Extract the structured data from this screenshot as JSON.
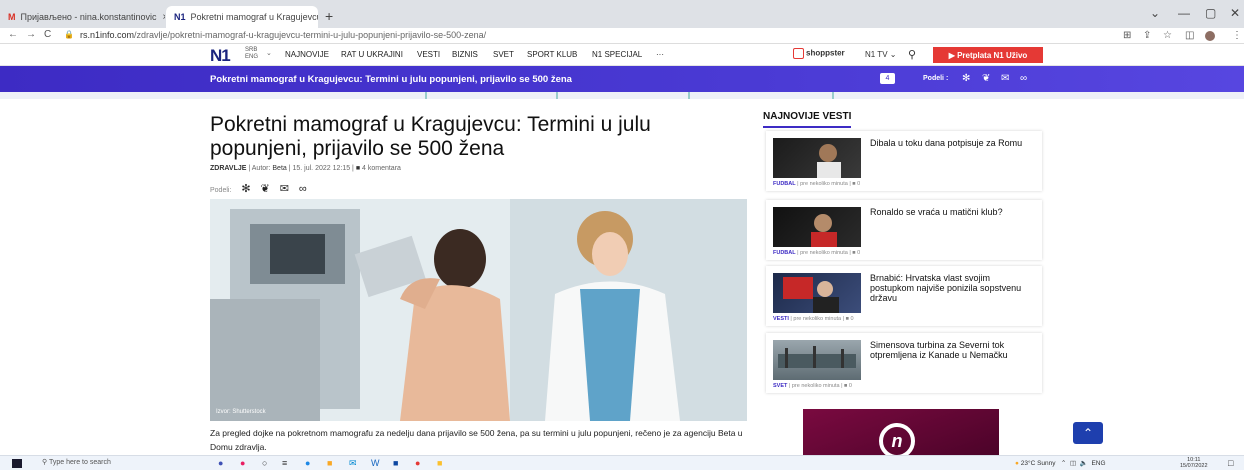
{
  "browser": {
    "tabs": [
      {
        "favicon": "M",
        "label": "Пријављено - nina.konstantinovic",
        "close": "×"
      },
      {
        "favicon": "N1",
        "label": "Pokretni mamograf u Kragujevcu",
        "close": "×"
      }
    ],
    "new_tab": "+",
    "url_host": "rs.n1info.com",
    "url_path": "/zdravlje/pokretni-mamograf-u-kragujevcu-termini-u-julu-popunjeni-prijavilo-se-500-zena/",
    "nav": {
      "back": "←",
      "forward": "→",
      "reload": "C"
    },
    "window": {
      "chevron": "⌄",
      "minimize": "—",
      "maximize": "▢",
      "close": "✕"
    }
  },
  "site": {
    "logo": "N1",
    "lang": {
      "primary": "SRB",
      "secondary": "ENG"
    },
    "menu": [
      "NAJNOVIJE",
      "RAT U UKRAJINI",
      "VESTI",
      "BIZNIS",
      "SVET",
      "SPORT KLUB",
      "N1 SPECIJAL",
      "···"
    ],
    "shoppster": "shoppster",
    "n1tv": "N1 TV ⌄",
    "subscribe": "▶ Pretplata N1 Uživo"
  },
  "sticky": {
    "title": "Pokretni mamograf u Kragujevcu: Termini u julu popunjeni, prijavilo se 500 žena",
    "comment_count": "4",
    "share_label": "Podeli :"
  },
  "article": {
    "title": "Pokretni mamograf u Kragujevcu: Termini u julu popunjeni, prijavilo se 500 žena",
    "category": "ZDRAVLJE",
    "author_prefix": " | Autor: ",
    "author": "Beta",
    "date": " | 15. jul. 2022 12:15 | ",
    "comments": "4 komentara",
    "share_label": "Podeli:",
    "image_caption": "Izvor: Shutterstock",
    "lead": "Za pregled dojke na pokretnom mamografu za nedelju dana prijavilo se 500 žena, pa su termini u julu popunjeni, rečeno je za agenciju Beta u Domu zdravlja."
  },
  "sidebar": {
    "title": "NAJNOVIJE VESTI",
    "items": [
      {
        "title": "Dibala u toku dana potpisuje za Romu",
        "category": "FUDBAL",
        "time": " | pre nekoliko minuta | ",
        "comments": "0"
      },
      {
        "title": "Ronaldo se vraća u matični klub?",
        "category": "FUDBAL",
        "time": " | pre nekoliko minuta | ",
        "comments": "0"
      },
      {
        "title": "Brnabić: Hrvatska vlast svojim postupkom najviše ponizila sopstvenu državu",
        "category": "VESTI",
        "time": " | pre nekoliko minuta | ",
        "comments": "0"
      },
      {
        "title": "Simensova turbina za Severni tok otpremljena iz Kanade u Nemačku",
        "category": "SVET",
        "time": " | pre nekoliko minuta | ",
        "comments": "0"
      }
    ]
  },
  "taskbar": {
    "search_placeholder": "Type here to search",
    "weather": "23°C  Sunny",
    "lang": "ENG",
    "time": "10:11",
    "date": "15/07/2022"
  }
}
